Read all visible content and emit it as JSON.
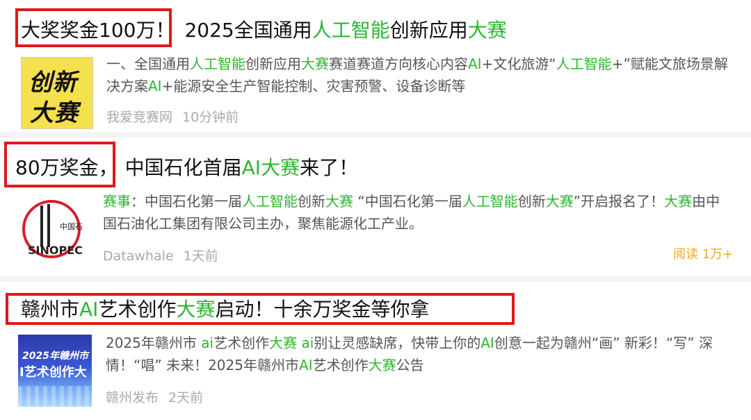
{
  "results": [
    {
      "title_prefix": "大奖奖金100万！",
      "title_parts": [
        "2025全国通用",
        "人工智能",
        "创新应用",
        "大赛"
      ],
      "thumb_label_1": "创新",
      "thumb_label_2": "大赛",
      "snippet_parts": [
        "一、全国通用",
        "人工智能",
        "创新应用",
        "大赛",
        "赛道赛道方向核心内容",
        "AI",
        "+文化旅游“",
        "人工智能",
        "+”赋能文旅场景解决方案",
        "AI",
        "+能源安全生产智能控制、灾害预警、设备诊断等"
      ],
      "source": "我爱竞赛网",
      "time": "10分钟前"
    },
    {
      "title_prefix": "80万奖金，",
      "title_parts": [
        "中国石化首届",
        "AI大赛",
        "来了！"
      ],
      "thumb_label": "SINOPEC",
      "thumb_cn": "中国石化",
      "snippet_parts": [
        "赛事",
        "：中国石化第一届",
        "人工智能",
        "创新",
        "大赛",
        " “中国石化第一届",
        "人工智能",
        "创新",
        "大赛",
        "”开启报名了！",
        "大赛",
        "由中国石油化工集团有限公司主办，聚焦能源化工产业。"
      ],
      "source": "Datawhale",
      "time": "1天前",
      "reads": "阅读 1万+"
    },
    {
      "title_parts": [
        "赣州市",
        "AI",
        "艺术创作",
        "大赛",
        "启动！十余万奖金等你拿"
      ],
      "thumb_label_1": "2025年赣州市",
      "thumb_label_2": "I艺术创作大",
      "snippet_parts": [
        "2025年赣州市 ",
        "ai",
        "艺术创作",
        "大赛",
        " ",
        "ai",
        "别让灵感缺席，快带上你的",
        "AI",
        "创意一起为赣州“画” 新彩！“写” 深情！“唱” 未来！2025年赣州市",
        "AI",
        "艺术创作",
        "大赛",
        "公告"
      ],
      "source": "赣州发布",
      "time": "2天前"
    }
  ],
  "colors": {
    "highlight": "#2db52f",
    "annotation_box": "#e01818",
    "read_count": "#f5a623"
  }
}
